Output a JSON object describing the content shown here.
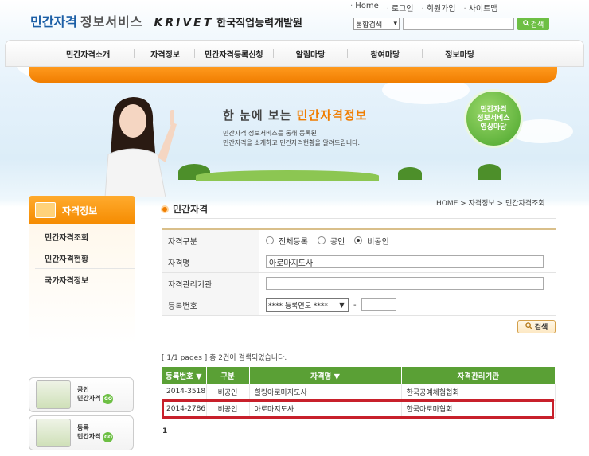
{
  "header": {
    "logo_part1": "민간자격",
    "logo_part2": "정보서비스",
    "logo_org_en": "KRIVET",
    "logo_org_ko": "한국직업능력개발원",
    "util_links": [
      "Home",
      "로그인",
      "회원가입",
      "사이트맵"
    ],
    "search_scope": "통합검색",
    "search_value": "",
    "search_button": "검색"
  },
  "nav": {
    "items": [
      "민간자격소개",
      "자격정보",
      "민간자격등록신청",
      "알림마당",
      "참여마당",
      "정보마당"
    ]
  },
  "hero": {
    "title_pre": "한 눈에 보는 ",
    "title_highlight": "민간자격정보",
    "desc_line1": "민간자격 정보서비스를 통해 등록된",
    "desc_line2": "민간자격을 소개하고 민간자격현황을 알려드립니다.",
    "circle_line1": "민간자격",
    "circle_line2": "정보서비스",
    "circle_line3": "영상마당"
  },
  "sidebar": {
    "title": "자격정보",
    "items": [
      "민간자격조회",
      "민간자격현황",
      "국가자격정보"
    ],
    "banners": [
      {
        "line1": "공인",
        "line2": "민간자격",
        "go": "GO"
      },
      {
        "line1": "등록",
        "line2": "민간자격",
        "go": "GO"
      }
    ]
  },
  "content": {
    "title": "민간자격",
    "breadcrumb": "HOME > 자격정보 > 민간자격조회",
    "form": {
      "type_label": "자격구분",
      "type_options": [
        "전체등록",
        "공인",
        "비공인"
      ],
      "type_selected": "비공인",
      "name_label": "자격명",
      "name_value": "아로마지도사",
      "org_label": "자격관리기관",
      "org_value": "",
      "regno_label": "등록번호",
      "regno_year": "**** 등록연도 ****",
      "regno_dash": "-",
      "regno_value": ""
    },
    "search_button": "검색",
    "summary": "[ 1/1 pages ] 총 2건이 검색되었습니다.",
    "table": {
      "headers": [
        "등록번호 ▼",
        "구분",
        "자격명 ▼",
        "자격관리기관"
      ],
      "rows": [
        [
          "2014-3518",
          "비공인",
          "힐링아로마지도사",
          "한국공예체험협회"
        ],
        [
          "2014-2786",
          "비공인",
          "아로마지도사",
          "한국아로마협회"
        ]
      ]
    },
    "pager": "1"
  },
  "colors": {
    "accent_orange": "#f07d00",
    "table_header_green": "#5aa035",
    "highlight_red": "#c8202b",
    "logo_blue": "#1c5fa6"
  }
}
